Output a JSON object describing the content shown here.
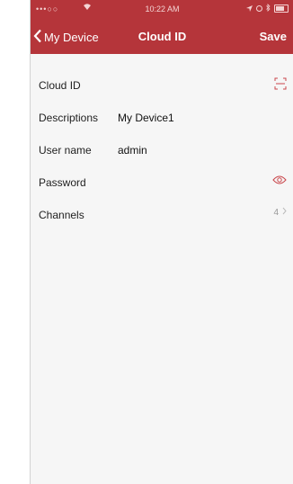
{
  "status_bar": {
    "signal": "•••○○",
    "time": "10:22 AM"
  },
  "nav": {
    "back_label": "My Device",
    "title": "Cloud ID",
    "save_label": "Save"
  },
  "form": {
    "rows": [
      {
        "label": "Cloud ID",
        "value": ""
      },
      {
        "label": "Descriptions",
        "value": "My Device1"
      },
      {
        "label": "User name",
        "value": "admin"
      },
      {
        "label": "Password",
        "value": ""
      },
      {
        "label": "Channels",
        "value": "4"
      }
    ]
  },
  "icons": {
    "back": "chevron-left-icon",
    "scan": "qr-scan-icon",
    "password_toggle": "eye-icon",
    "channels_arrow": "chevron-right-icon"
  },
  "colors": {
    "header": "#b5353a",
    "icon_accent": "#c9474c"
  }
}
